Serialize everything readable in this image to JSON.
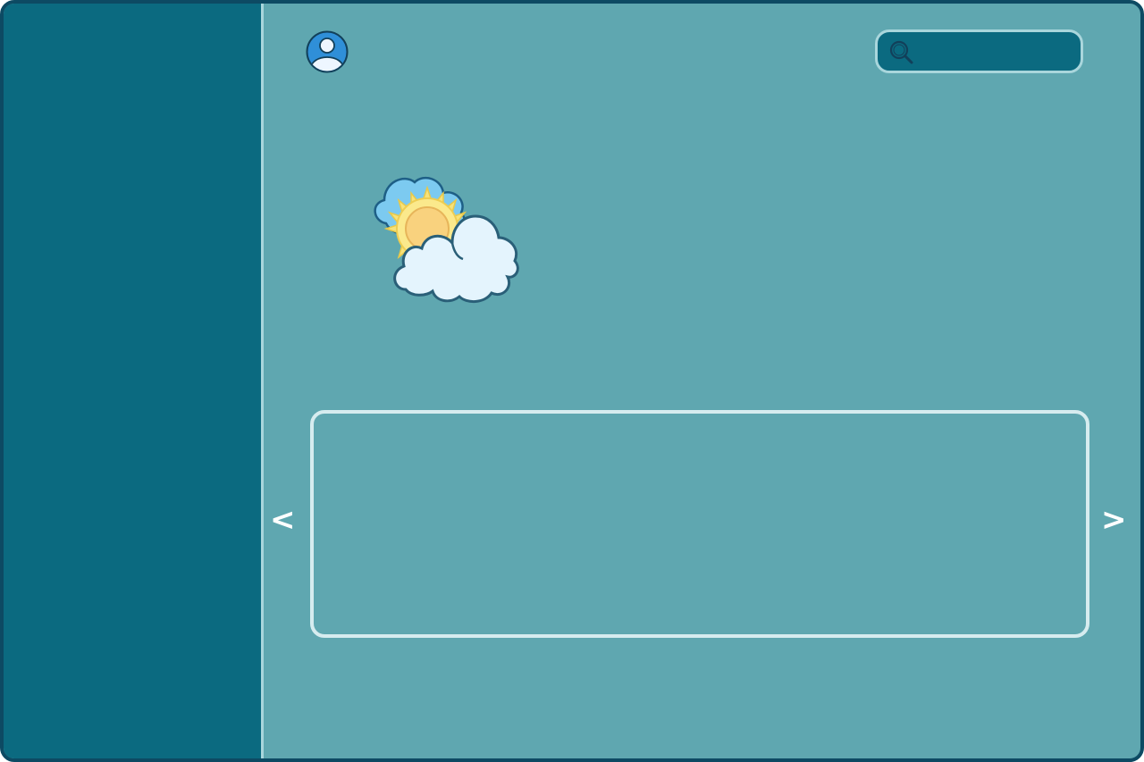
{
  "header": {
    "avatar_icon": "user-avatar-icon",
    "search": {
      "icon": "search-icon",
      "placeholder": "",
      "value": ""
    }
  },
  "main": {
    "weather_icon": "partly-cloudy-icon",
    "carousel": {
      "prev_label": "<",
      "next_label": ">"
    }
  },
  "colors": {
    "sidebar": "#0b6a80",
    "content_bg": "#5fa7b0",
    "frame_border": "#0d4a63",
    "accent_outline": "#a9d6dc",
    "avatar_blue": "#2f8fd8"
  }
}
